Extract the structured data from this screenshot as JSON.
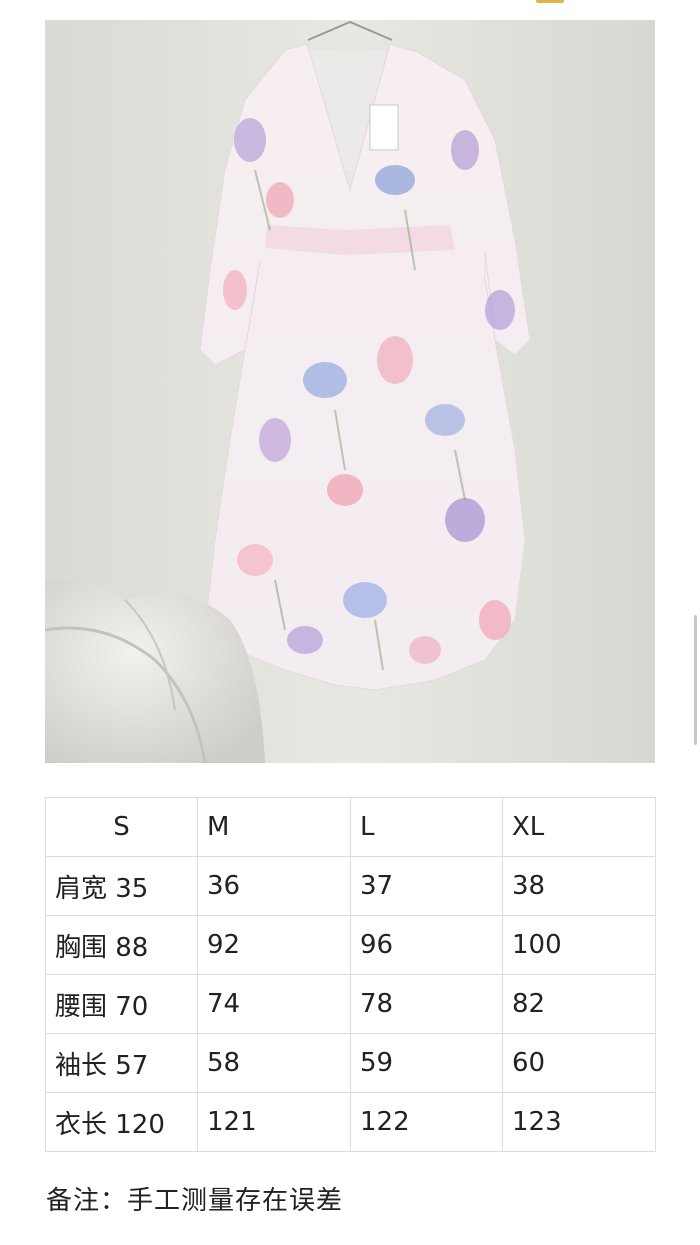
{
  "product_image": {
    "alt": "",
    "icon": "floral-dress-photo"
  },
  "size_table": {
    "header": [
      "S",
      "M",
      "L",
      "XL"
    ],
    "rows": [
      [
        "肩宽 35",
        "36",
        "37",
        "38"
      ],
      [
        "胸围 88",
        "92",
        "96",
        "100"
      ],
      [
        "腰围 70",
        "74",
        "78",
        "82"
      ],
      [
        "袖长 57",
        "58",
        "59",
        "60"
      ],
      [
        "衣长 120",
        "121",
        "122",
        "123"
      ]
    ]
  },
  "note": "备注：手工测量存在误差",
  "colors": {
    "table_border": "#dcdcdc",
    "text": "#222222",
    "background": "#ffffff"
  }
}
